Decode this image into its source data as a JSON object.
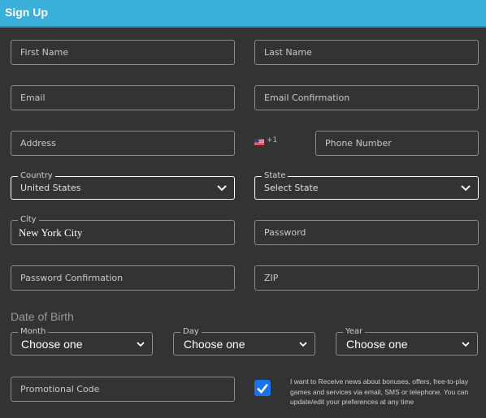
{
  "header": {
    "title": "Sign Up",
    "color": "#3aafda"
  },
  "fields": {
    "first_name": {
      "placeholder": "First Name"
    },
    "last_name": {
      "placeholder": "Last Name"
    },
    "email": {
      "placeholder": "Email"
    },
    "email_confirmation": {
      "placeholder": "Email Confirmation"
    },
    "address": {
      "placeholder": "Address"
    },
    "phone_prefix": "+1",
    "phone_flag": "us-flag-icon",
    "phone_number": {
      "placeholder": "Phone Number"
    },
    "country": {
      "label": "Country",
      "value": "United States"
    },
    "state": {
      "label": "State",
      "value": "Select State"
    },
    "city": {
      "label": "City",
      "value": "New York City"
    },
    "password": {
      "placeholder": "Password"
    },
    "password_confirmation": {
      "placeholder": "Password Confirmation"
    },
    "zip": {
      "placeholder": "ZIP"
    },
    "promo_code": {
      "placeholder": "Promotional Code"
    }
  },
  "dob": {
    "title": "Date of Birth",
    "month": {
      "label": "Month",
      "value": "Choose one"
    },
    "day": {
      "label": "Day",
      "value": "Choose one"
    },
    "year": {
      "label": "Year",
      "value": "Choose one"
    }
  },
  "consent": {
    "checked": true,
    "text": "I want to Receive news about bonuses, offers, free-to-play games and services via email, SMS or telephone. You can update/edit your preferences at any time",
    "checkbox_color": "#1a73e8"
  }
}
